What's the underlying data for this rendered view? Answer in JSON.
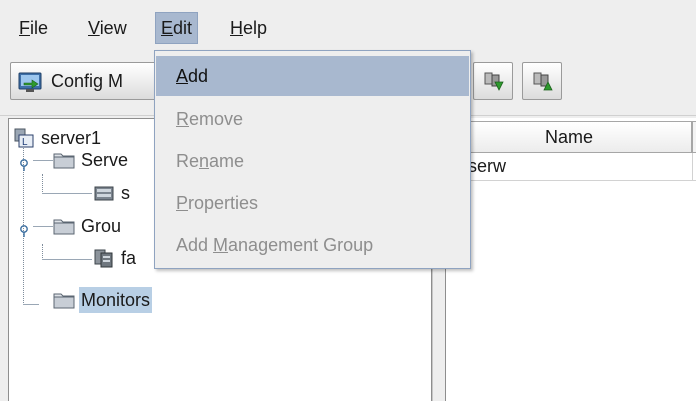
{
  "menubar": {
    "items": [
      {
        "pre": "",
        "mnemonic": "F",
        "post": "ile"
      },
      {
        "pre": "",
        "mnemonic": "V",
        "post": "iew"
      },
      {
        "pre": "",
        "mnemonic": "E",
        "post": "dit"
      },
      {
        "pre": "",
        "mnemonic": "H",
        "post": "elp"
      }
    ]
  },
  "toolbar": {
    "config_label": "Config M",
    "icons": [
      "config-monitor-icon",
      "servers-down-icon",
      "servers-up-icon"
    ]
  },
  "edit_menu": {
    "items": [
      {
        "pre": "",
        "mnemonic": "A",
        "post": "dd",
        "state": "highlighted"
      },
      {
        "pre": "",
        "mnemonic": "R",
        "post": "emove",
        "state": "disabled"
      },
      {
        "pre": "Re",
        "mnemonic": "n",
        "post": "ame",
        "state": "disabled"
      },
      {
        "pre": "",
        "mnemonic": "P",
        "post": "roperties",
        "state": "disabled"
      },
      {
        "pre": "Add ",
        "mnemonic": "M",
        "post": "anagement Group",
        "state": "disabled"
      }
    ]
  },
  "tree": {
    "nodes": [
      {
        "label": "server1",
        "icon": "cluster-icon"
      },
      {
        "label": "Serve",
        "icon": "folder-icon"
      },
      {
        "label": "s",
        "icon": "server-icon"
      },
      {
        "label": "Grou",
        "icon": "folder-icon"
      },
      {
        "label": "fa",
        "icon": "failover-group-icon"
      },
      {
        "label": "Monitors",
        "icon": "folder-icon",
        "selected": true
      }
    ]
  },
  "table": {
    "columns": [
      "Name"
    ],
    "rows": [
      [
        "serw"
      ]
    ]
  },
  "colors": {
    "highlight": "#a8b8cf",
    "selection": "#b8cfe5",
    "disabled_text": "#8e8e8e"
  }
}
